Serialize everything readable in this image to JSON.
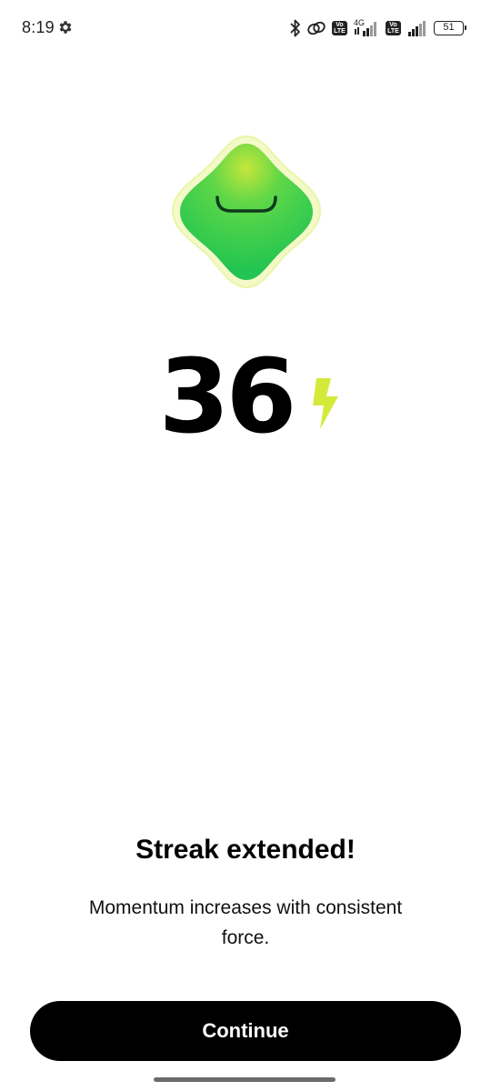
{
  "status_bar": {
    "time": "8:19",
    "network_label": "4G",
    "volte_label": "Vo\nLTE",
    "battery_level": "51",
    "icons": [
      "gear-icon",
      "bluetooth-icon",
      "link-icon",
      "volte-icon",
      "signal-icon",
      "battery-icon"
    ]
  },
  "mascot": {
    "icon": "green-smiling-blob-mascot",
    "colors": {
      "body": "#2ecc55",
      "glow": "#f3f9b0",
      "highlight": "#c8ec3c"
    }
  },
  "streak": {
    "count": "36",
    "icon": "lightning-bolt-icon",
    "bolt_color": "#d4ea3a"
  },
  "message": {
    "headline": "Streak extended!",
    "subtext": "Momentum increases with consistent force."
  },
  "actions": {
    "continue_label": "Continue"
  }
}
